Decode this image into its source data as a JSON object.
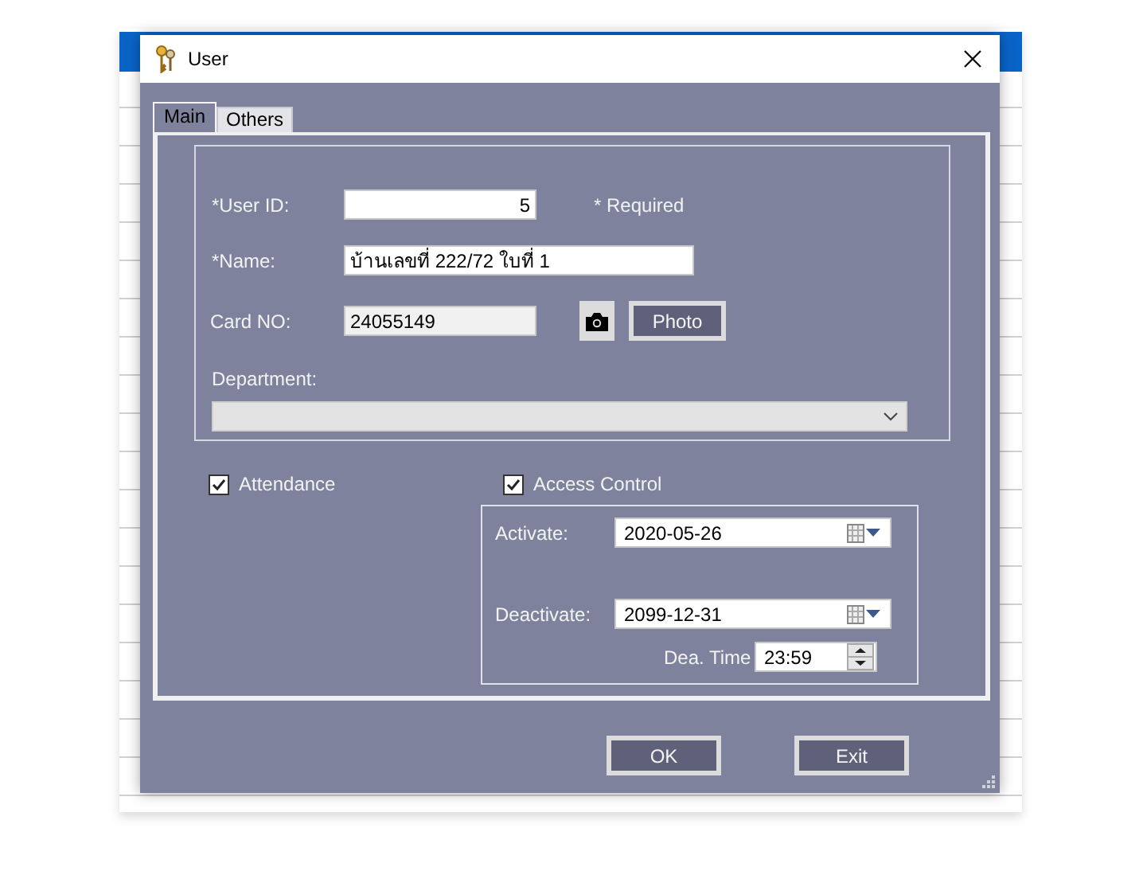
{
  "window": {
    "title": "User"
  },
  "tabs": [
    {
      "label": "Main",
      "selected": true
    },
    {
      "label": "Others",
      "selected": false
    }
  ],
  "main": {
    "user_id": {
      "label": "*User ID:",
      "value": "5"
    },
    "required_note": "* Required",
    "name": {
      "label": "*Name:",
      "value": "บ้านเลขที่ 222/72 ใบที่ 1"
    },
    "card_no": {
      "label": "Card NO:",
      "value": "24055149",
      "readonly": true
    },
    "photo_button": "Photo",
    "department": {
      "label": "Department:"
    },
    "attendance": {
      "label": "Attendance",
      "checked": true
    },
    "access_control": {
      "label": "Access Control",
      "checked": true
    },
    "activate": {
      "label": "Activate:",
      "value": "2020-05-26"
    },
    "deactivate": {
      "label": "Deactivate:",
      "value": "2099-12-31"
    },
    "dea_time": {
      "label": "Dea. Time",
      "value": "23:59"
    }
  },
  "buttons": [
    "OK",
    "Exit"
  ]
}
